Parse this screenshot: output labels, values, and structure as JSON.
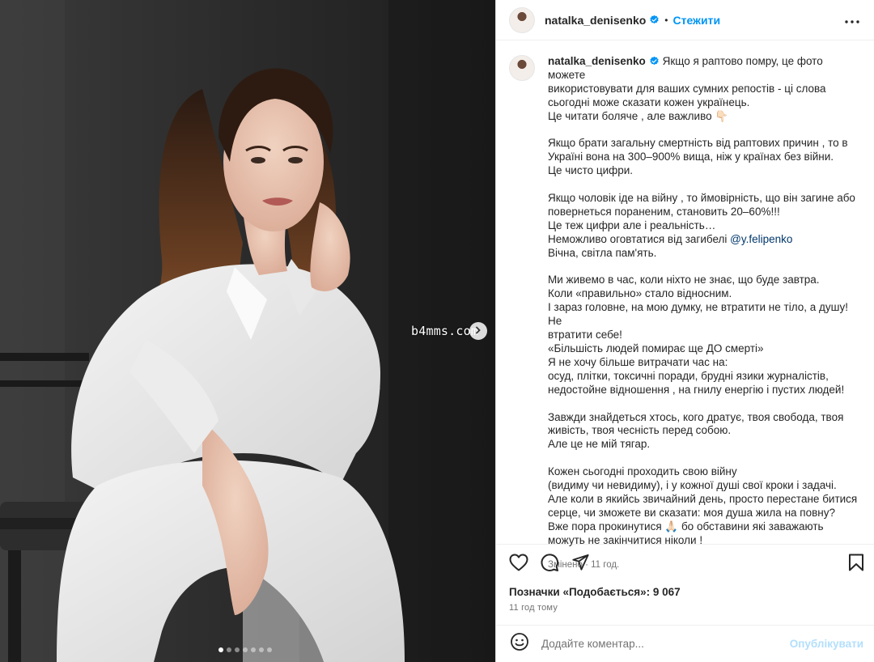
{
  "header": {
    "username": "natalka_denisenko",
    "separator": "•",
    "follow_label": "Стежити"
  },
  "caption": {
    "username": "natalka_denisenko",
    "lines": [
      "Якщо я раптово помру, це фото можете",
      "використовувати для ваших сумних репостів - ці слова",
      "сьогодні може сказати кожен українець.",
      "Це читати боляче , але важливо 👇🏻",
      "",
      "Якщо брати загальну смертність від раптових причин , то в",
      "Україні вона на 300–900% вища, ніж у країнах без війни.",
      "Це чисто цифри.",
      "",
      "Якщо чоловік іде на війну , то ймовірність, що він загине або",
      "повернеться пораненим, становить 20–60%!!!",
      "Це теж цифри але і реальність…",
      "Неможливо оговтатися від загибелі ",
      "Вічна, світла пам'ять.",
      "",
      "Ми живемо в час, коли ніхто не знає, що буде завтра.",
      "Коли «правильно» стало відносним.",
      "І зараз головне, на мою думку, не втратити не тіло, а душу! Не",
      "втратити себе!",
      "«Більшість людей помирає ще ДО смерті»",
      "Я не хочу більше витрачати час на:",
      "осуд, плітки, токсичні поради, брудні язики журналістів,",
      "недостойне відношення , на гнилу енергію і пустих людей!",
      "",
      "Завжди знайдеться хтось, кого дратує, твоя свобода, твоя",
      "живість, твоя чесність перед собою.",
      "Але це не мій тягар.",
      "",
      "Кожен сьогодні проходить свою війну",
      "(видиму чи невидиму), і у кожної душі свої кроки і задачі.",
      "Але коли в якийсь звичайний день, просто перестане битися",
      "серце, чи зможете ви сказати: моя душа жила на повну?",
      "Вже пора прокинутися 🙏🏻 бо обставини які заважають",
      "можуть не закінчитися ніколи !"
    ],
    "mention": "@y.felipenko",
    "edited_label": "Змінено · 11 год."
  },
  "likes_label": "Позначки «Подобається»: 9 067",
  "time_label": "11 год тому",
  "comment": {
    "placeholder": "Додайте коментар...",
    "post_label": "Опублікувати"
  },
  "media": {
    "watermark": "b4mms.com",
    "carousel_count": 7,
    "carousel_active": 1
  },
  "colors": {
    "accent": "#0095f6",
    "post_disabled": "#b2dffc",
    "verified": "#0095f6",
    "mention": "#00376b"
  },
  "icons": [
    "verified-badge-icon",
    "more-options-icon",
    "heart-icon",
    "comment-icon",
    "share-icon",
    "bookmark-icon",
    "emoji-icon",
    "chevron-right-icon"
  ]
}
